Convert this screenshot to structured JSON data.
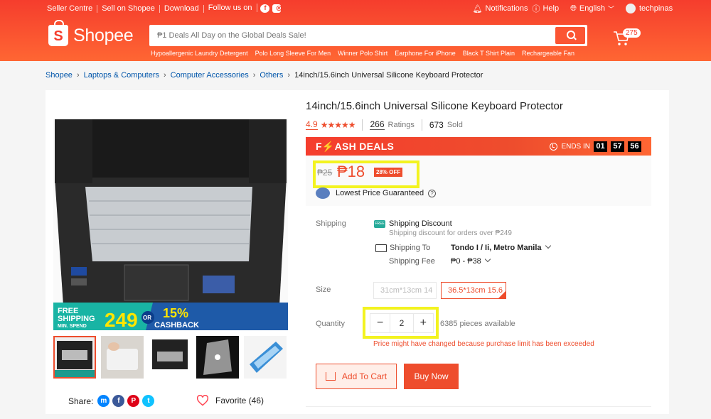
{
  "header": {
    "links": [
      "Seller Centre",
      "Sell on Shopee",
      "Download",
      "Follow us on"
    ],
    "social": [
      "f",
      "ig"
    ],
    "notifications": "Notifications",
    "help": "Help",
    "language": "English",
    "user": "techpinas",
    "logo": "Shopee",
    "search_placeholder": "₱1 Deals All Day on the Global Deals Sale!",
    "hints": [
      "Hypoallergenic Laundry Detergent",
      "Polo Long Sleeve For Men",
      "Winner Polo Shirt",
      "Earphone For iPhone",
      "Black T Shirt Plain",
      "Rechargeable Fan"
    ],
    "cart_count": "275"
  },
  "breadcrumb": [
    "Shopee",
    "Laptops & Computers",
    "Computer Accessories",
    "Others",
    "14inch/15.6inch Universal Silicone Keyboard Protector"
  ],
  "product": {
    "title": "14inch/15.6inch Universal Silicone Keyboard Protector",
    "rating": "4.9",
    "stars": "★★★★★",
    "ratings_count": "266",
    "ratings_label": "Ratings",
    "sold_count": "673",
    "sold_label": "Sold",
    "flash_label": "F⚡ASH DEALS",
    "ends_in": "ENDS IN",
    "timer": [
      "01",
      "57",
      "56"
    ],
    "old_price": "₱25",
    "price": "₱18",
    "discount": "28% OFF",
    "lowest_price": "Lowest Price Guaranteed",
    "shipping_label": "Shipping",
    "shipping_discount": "Shipping Discount",
    "shipping_discount_sub": "Shipping discount for orders over ₱249",
    "shipping_to_label": "Shipping To",
    "shipping_to": "Tondo I / Ii, Metro Manila",
    "shipping_fee_label": "Shipping Fee",
    "shipping_fee": "₱0 - ₱38",
    "size_label": "Size",
    "sizes": [
      "31cm*13cm 14",
      "36.5*13cm 15.6"
    ],
    "quantity_label": "Quantity",
    "quantity": "2",
    "available": "6385 pieces available",
    "warning": "Price might have changed because purchase limit has been exceeded",
    "add_to_cart": "Add To Cart",
    "buy_now": "Buy Now"
  },
  "banner": {
    "line1": "FREE",
    "line2": "SHIPPING",
    "line3": "MIN. SPEND",
    "amount": "249",
    "or": "OR",
    "pct": "15%",
    "cashback": "CASHBACK"
  },
  "share_label": "Share:",
  "favorite": "Favorite (46)",
  "colors": {
    "brand": "#ee4d2d",
    "highlight": "#f3f320"
  }
}
